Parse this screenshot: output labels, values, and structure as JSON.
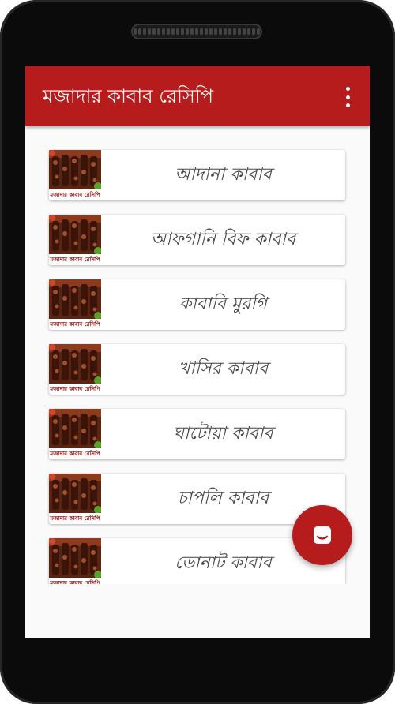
{
  "app": {
    "title": "মজাদার কাবাব রেসিপি",
    "thumbnail_caption": "মজাদার কাবাব রেসিপি",
    "colors": {
      "primary": "#b71c1c",
      "background": "#fafafa"
    }
  },
  "toolbar": {
    "menu_icon": "more-vert-icon"
  },
  "recipes": [
    {
      "label": "আদানা কাবাব"
    },
    {
      "label": "আফগানি বিফ কাবাব"
    },
    {
      "label": "কাবাবি মুরগি"
    },
    {
      "label": "খাসির কাবাব"
    },
    {
      "label": "ঘাটোয়া কাবাব"
    },
    {
      "label": "চাপলি কাবাব"
    },
    {
      "label": "ডোনাট কাবাব"
    }
  ],
  "fab": {
    "icon": "chat-icon"
  }
}
